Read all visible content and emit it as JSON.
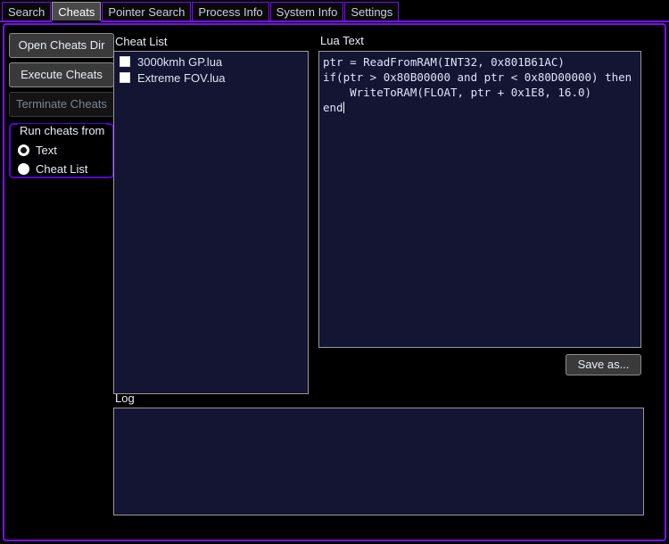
{
  "window": {
    "accent_purple": "#7a0ff0",
    "panel_bg": "#141433",
    "button_bg": "#3a3a3a"
  },
  "tabs": [
    {
      "label": "Search",
      "active": false
    },
    {
      "label": "Cheats",
      "active": true
    },
    {
      "label": "Pointer Search",
      "active": false
    },
    {
      "label": "Process Info",
      "active": false
    },
    {
      "label": "System Info",
      "active": false
    },
    {
      "label": "Settings",
      "active": false
    }
  ],
  "sidebar": {
    "open_cheats_dir": "Open Cheats Dir",
    "execute_cheats": "Execute Cheats",
    "terminate_cheats": "Terminate Cheats",
    "group": {
      "title": "Run cheats from",
      "options": [
        {
          "label": "Text",
          "selected": true
        },
        {
          "label": "Cheat List",
          "selected": false
        }
      ]
    }
  },
  "cheat_list": {
    "label": "Cheat List",
    "items": [
      {
        "name": "3000kmh GP.lua",
        "checked": false
      },
      {
        "name": "Extreme FOV.lua",
        "checked": false
      }
    ]
  },
  "lua_text": {
    "label": "Lua Text",
    "code": "ptr = ReadFromRAM(INT32, 0x801B61AC)\nif(ptr > 0x80B00000 and ptr < 0x80D00000) then\n    WriteToRAM(FLOAT, ptr + 0x1E8, 16.0)\nend",
    "save_as_label": "Save as..."
  },
  "log": {
    "label": "Log",
    "content": ""
  }
}
